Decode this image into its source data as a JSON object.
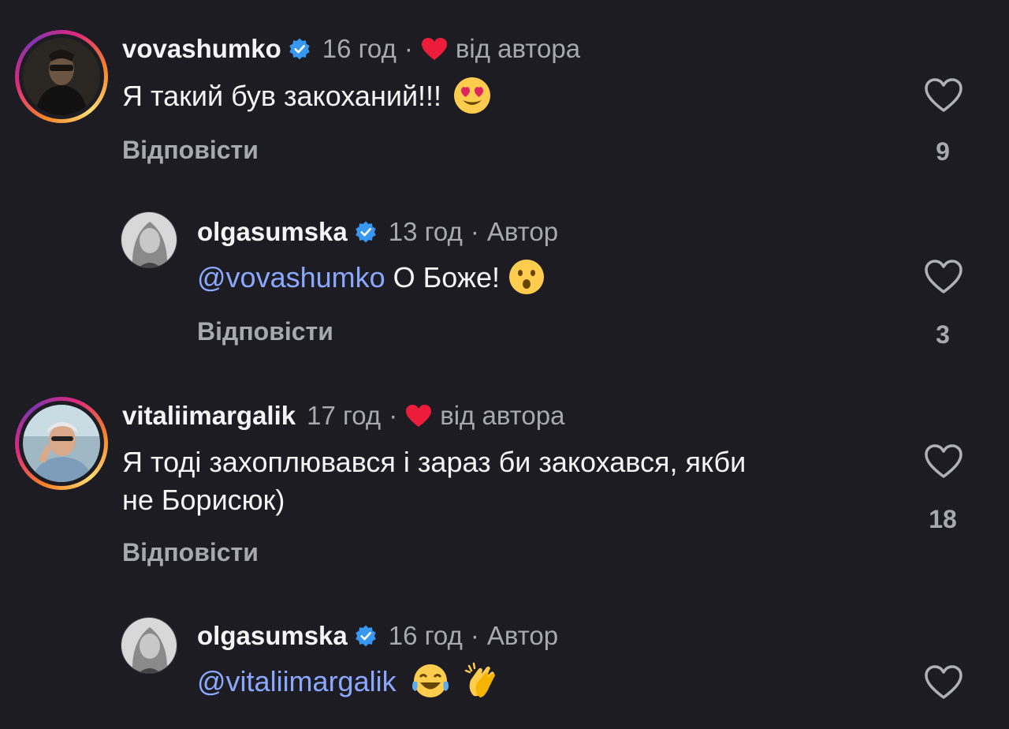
{
  "comments": [
    {
      "username": "vovashumko",
      "time": "16 год",
      "liked_by_author_label": "від автора",
      "text": "Я такий був закоханий!!!",
      "emoji": "heart-eyes",
      "reply_label": "Відповісти",
      "likes": "9"
    },
    {
      "username": "olgasumska",
      "time": "13 год",
      "author_label": "Автор",
      "mention": "@vovashumko",
      "text": "О Боже!",
      "emoji": "astonished",
      "reply_label": "Відповісти",
      "likes": "3"
    },
    {
      "username": "vitaliimargalik",
      "time": "17 год",
      "liked_by_author_label": "від автора",
      "text_line1": "Я тоді захоплювався і зараз би закохався, якби",
      "text_line2": "не Борисюк)",
      "reply_label": "Відповісти",
      "likes": "18"
    },
    {
      "username": "olgasumska",
      "time": "16 год",
      "author_label": "Автор",
      "mention": "@vitaliimargalik",
      "emoji": [
        "tears-of-joy",
        "clapping-hands"
      ]
    }
  ],
  "dot": "·",
  "colors": {
    "background": "#1c1c22",
    "mention": "#8ba8ff",
    "verified": "#3897f0",
    "heart": "#ed1c3a",
    "secondary_text": "#a8a8b0"
  }
}
